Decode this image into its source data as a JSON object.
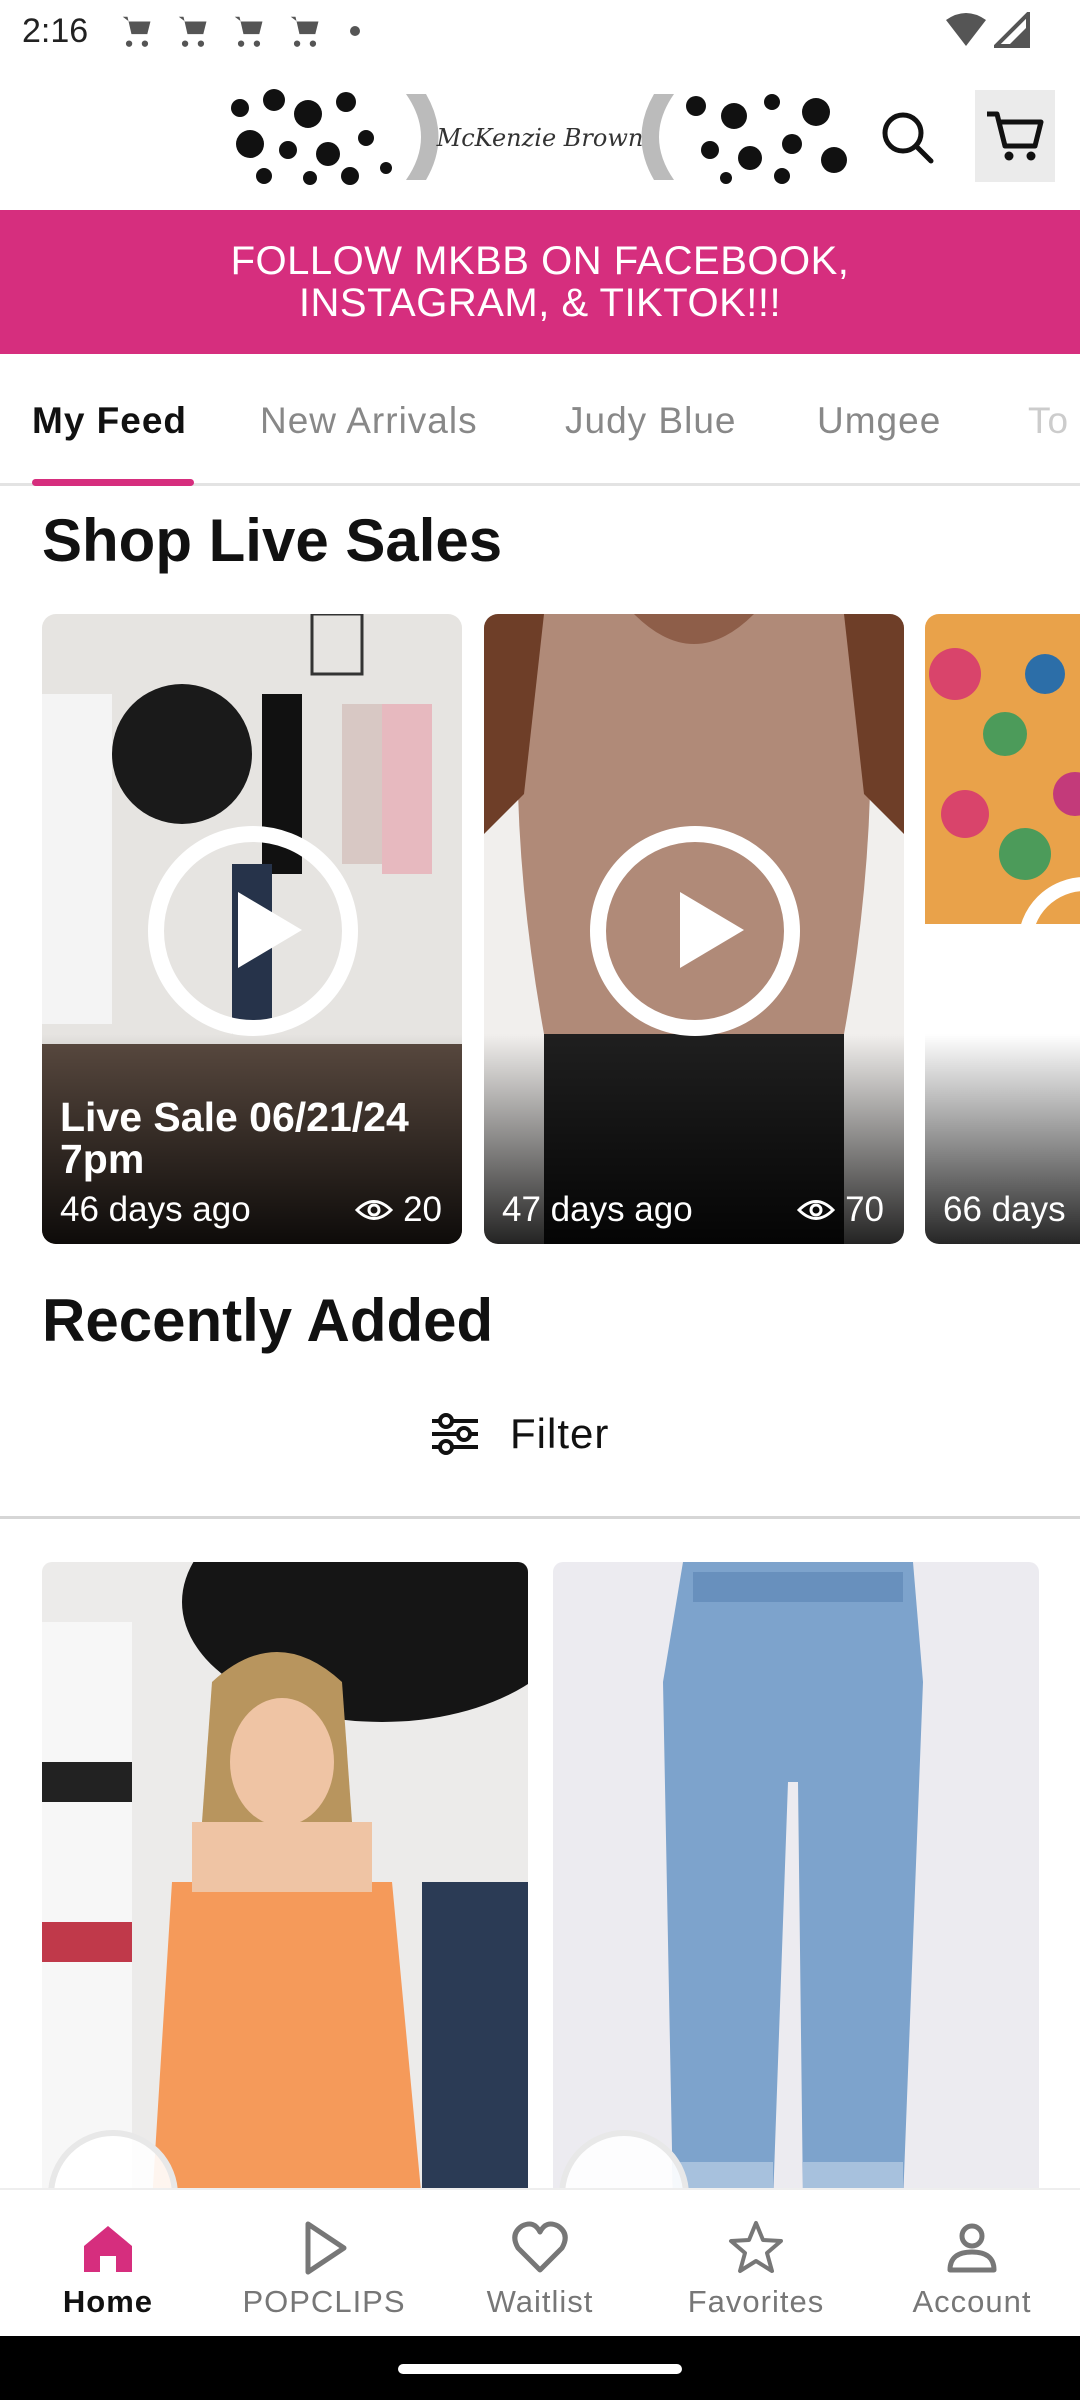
{
  "status_bar": {
    "time": "2:16"
  },
  "header": {
    "logo_text": "McKenzie Brown",
    "icons": [
      "search-icon",
      "cart-icon"
    ]
  },
  "banner": {
    "line1": "FOLLOW MKBB ON FACEBOOK,",
    "line2": "INSTAGRAM, & TIKTOK!!!"
  },
  "tabs": [
    "My Feed",
    "New Arrivals",
    "Judy Blue",
    "Umgee",
    "To"
  ],
  "live_sales": {
    "title": "Shop Live Sales",
    "cards": [
      {
        "title": "Live Sale 06/21/24 7pm",
        "age": "46 days ago",
        "views": "20"
      },
      {
        "title": "",
        "age": "47 days ago",
        "views": "70"
      },
      {
        "title": "",
        "age": "66 days",
        "views": ""
      }
    ]
  },
  "recently_added": {
    "title": "Recently Added",
    "filter_label": "Filter"
  },
  "bottom_nav": [
    {
      "label": "Home",
      "icon": "home-icon",
      "active": true
    },
    {
      "label": "POPCLIPS",
      "icon": "play-icon",
      "active": false
    },
    {
      "label": "Waitlist",
      "icon": "heart-icon",
      "active": false
    },
    {
      "label": "Favorites",
      "icon": "star-icon",
      "active": false
    },
    {
      "label": "Account",
      "icon": "person-icon",
      "active": false
    }
  ],
  "colors": {
    "accent": "#d62e7e",
    "banner_text": "#ffffff"
  }
}
